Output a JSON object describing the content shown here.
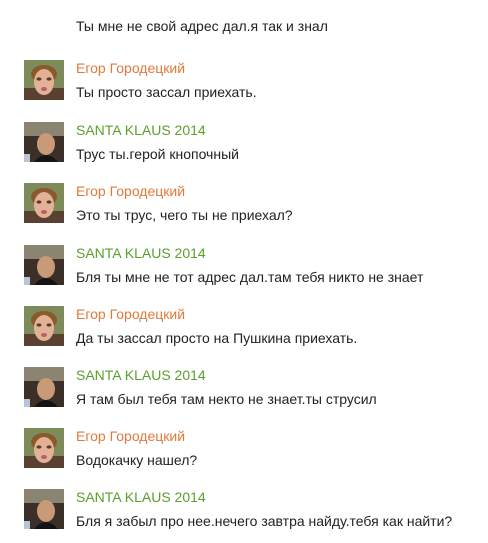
{
  "chat": {
    "first_message": "Ты мне не свой адрес дал.я так и знал",
    "messages": [
      {
        "author": "Егор Городецкий",
        "text": "Ты просто зассал приехать.",
        "avatar": "egor-avatar",
        "color": "#e07a3a"
      },
      {
        "author": "SANTA KLAUS 2014",
        "text": "Трус ты.герой кнопочный",
        "avatar": "santa-avatar",
        "color": "#5aa02c"
      },
      {
        "author": "Егор Городецкий",
        "text": "Это ты трус, чего ты не приехал?",
        "avatar": "egor-avatar",
        "color": "#e07a3a"
      },
      {
        "author": "SANTA KLAUS 2014",
        "text": "Бля ты мне не тот адрес дал.там тебя никто не знает",
        "avatar": "santa-avatar",
        "color": "#5aa02c"
      },
      {
        "author": "Егор Городецкий",
        "text": "Да ты зассал просто на Пушкина приехать.",
        "avatar": "egor-avatar",
        "color": "#e07a3a"
      },
      {
        "author": "SANTA KLAUS 2014",
        "text": "Я там был тебя там некто не знает.ты струсил",
        "avatar": "santa-avatar",
        "color": "#5aa02c"
      },
      {
        "author": "Егор Городецкий",
        "text": "Водокачку нашел?",
        "avatar": "egor-avatar",
        "color": "#e07a3a"
      },
      {
        "author": "SANTA KLAUS 2014",
        "text": "Бля я забыл про нее.нечего завтра найду.тебя как найти?",
        "avatar": "santa-avatar",
        "color": "#5aa02c"
      }
    ]
  }
}
